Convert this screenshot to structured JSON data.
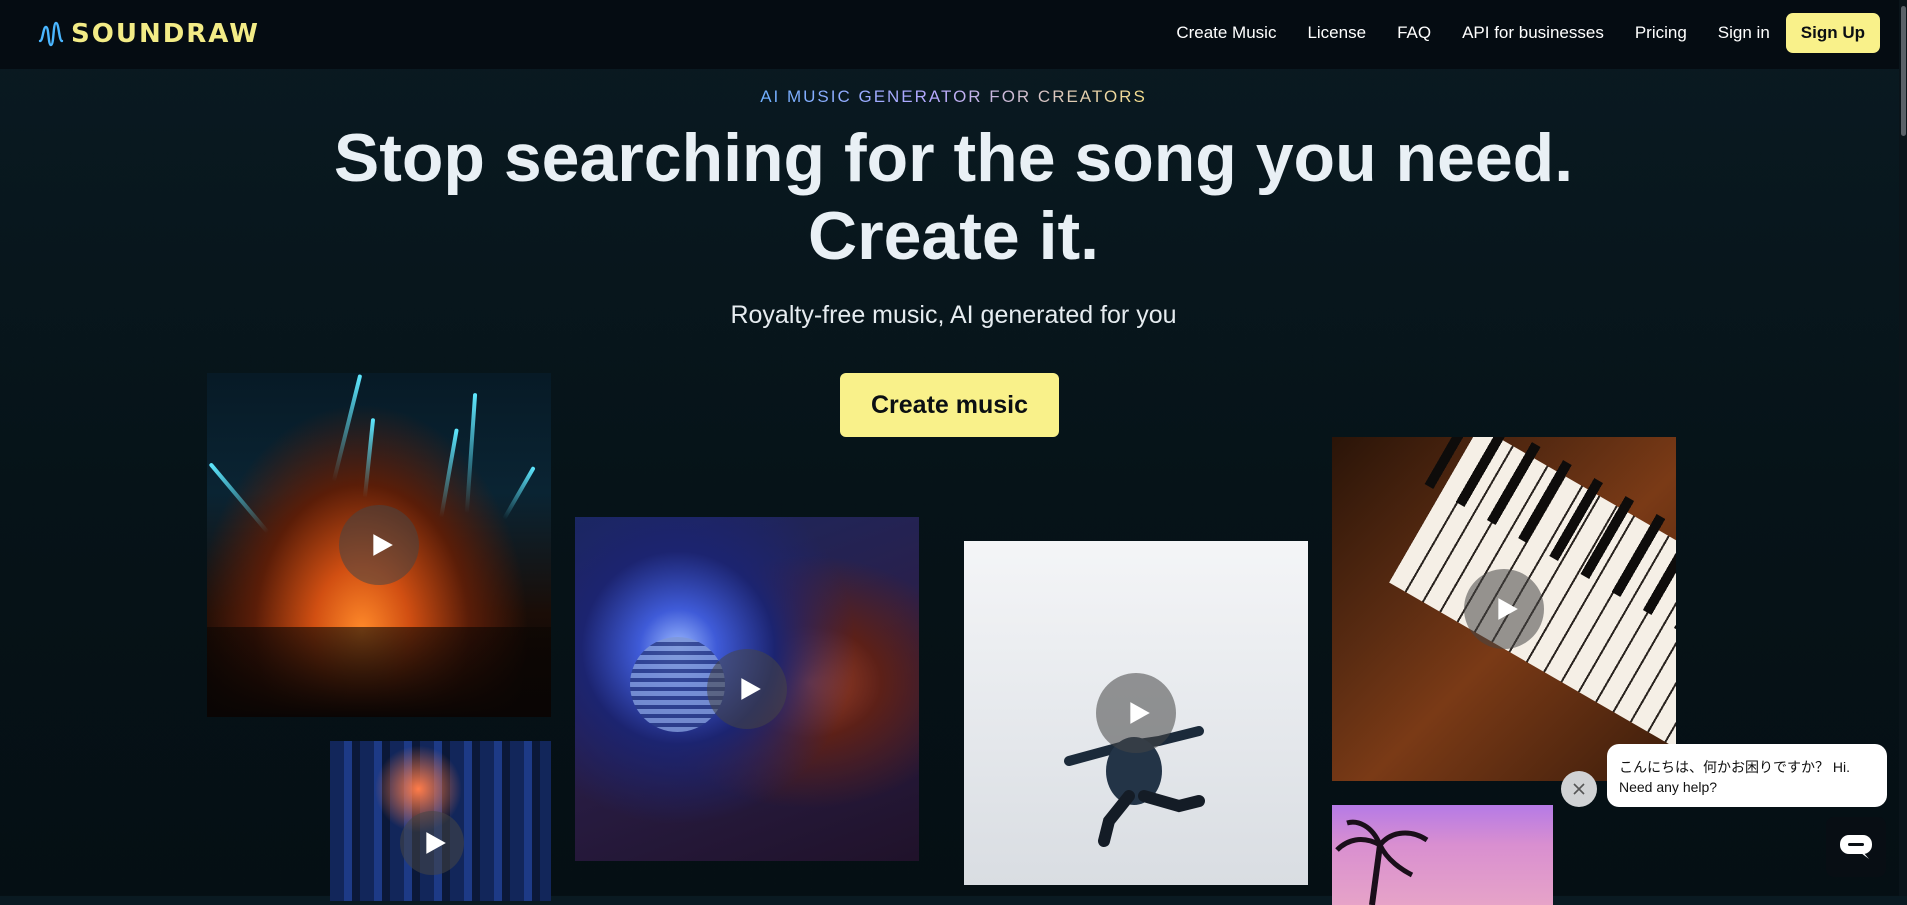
{
  "brand": {
    "name": "SOUNDRAW"
  },
  "nav": {
    "links": [
      "Create Music",
      "License",
      "FAQ",
      "API for businesses",
      "Pricing",
      "Sign in"
    ],
    "signup_label": "Sign Up"
  },
  "hero": {
    "eyebrow": "AI MUSIC GENERATOR FOR CREATORS",
    "headline_line1": "Stop searching for the song you need.",
    "headline_line2": "Create it.",
    "subhead": "Royalty-free music, AI generated for you",
    "cta_label": "Create music"
  },
  "tiles": [
    {
      "name": "concert"
    },
    {
      "name": "disco-ball"
    },
    {
      "name": "dancer"
    },
    {
      "name": "piano"
    },
    {
      "name": "city-night"
    },
    {
      "name": "palm-sunset"
    }
  ],
  "chat": {
    "message": "こんにちは、何かお困りですか？ Hi. Need any help?"
  },
  "colors": {
    "accent": "#f9f18a",
    "nav_bg": "#050c12",
    "page_bg": "#061318"
  }
}
